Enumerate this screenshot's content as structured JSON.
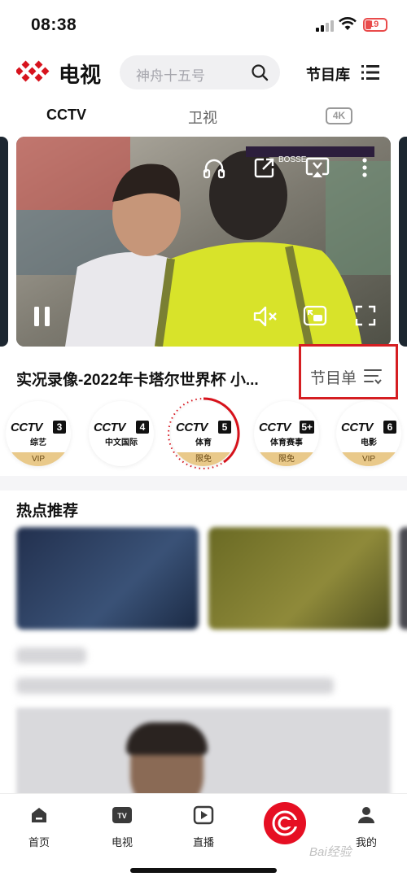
{
  "status_bar": {
    "time": "08:38",
    "battery": "19"
  },
  "header": {
    "app_title": "电视",
    "search_placeholder": "神舟十五号",
    "library_label": "节目库"
  },
  "tabs": [
    {
      "label": "CCTV"
    },
    {
      "label": "卫视"
    },
    {
      "label": "4K"
    }
  ],
  "player": {
    "scoreboard": "BOSSE"
  },
  "program": {
    "title": "实况录像-2022年卡塔尔世界杯 小...",
    "list_label": "节目单"
  },
  "channels": [
    {
      "logo": "CCTV",
      "number": "3",
      "subtitle": "综艺",
      "badge": "VIP"
    },
    {
      "logo": "CCTV",
      "number": "4",
      "subtitle": "中文国际",
      "badge": ""
    },
    {
      "logo": "CCTV",
      "number": "5",
      "subtitle": "体育",
      "badge": "限免"
    },
    {
      "logo": "CCTV",
      "number": "5+",
      "subtitle": "体育赛事",
      "badge": "限免"
    },
    {
      "logo": "CCTV",
      "number": "6",
      "subtitle": "电影",
      "badge": "VIP"
    }
  ],
  "hot_section": {
    "title": "热点推荐"
  },
  "bottom_nav": [
    {
      "label": "首页",
      "icon": "home-icon"
    },
    {
      "label": "电视",
      "icon": "tv-icon"
    },
    {
      "label": "直播",
      "icon": "live-play-icon"
    },
    {
      "label": "",
      "icon": "cctv-center-icon"
    },
    {
      "label": "我的",
      "icon": "profile-icon"
    }
  ],
  "watermark": "Bai经验",
  "colors": {
    "brand_red": "#e60f23",
    "highlight_box": "#d51e22",
    "vip_gold": "#e9c98a"
  }
}
